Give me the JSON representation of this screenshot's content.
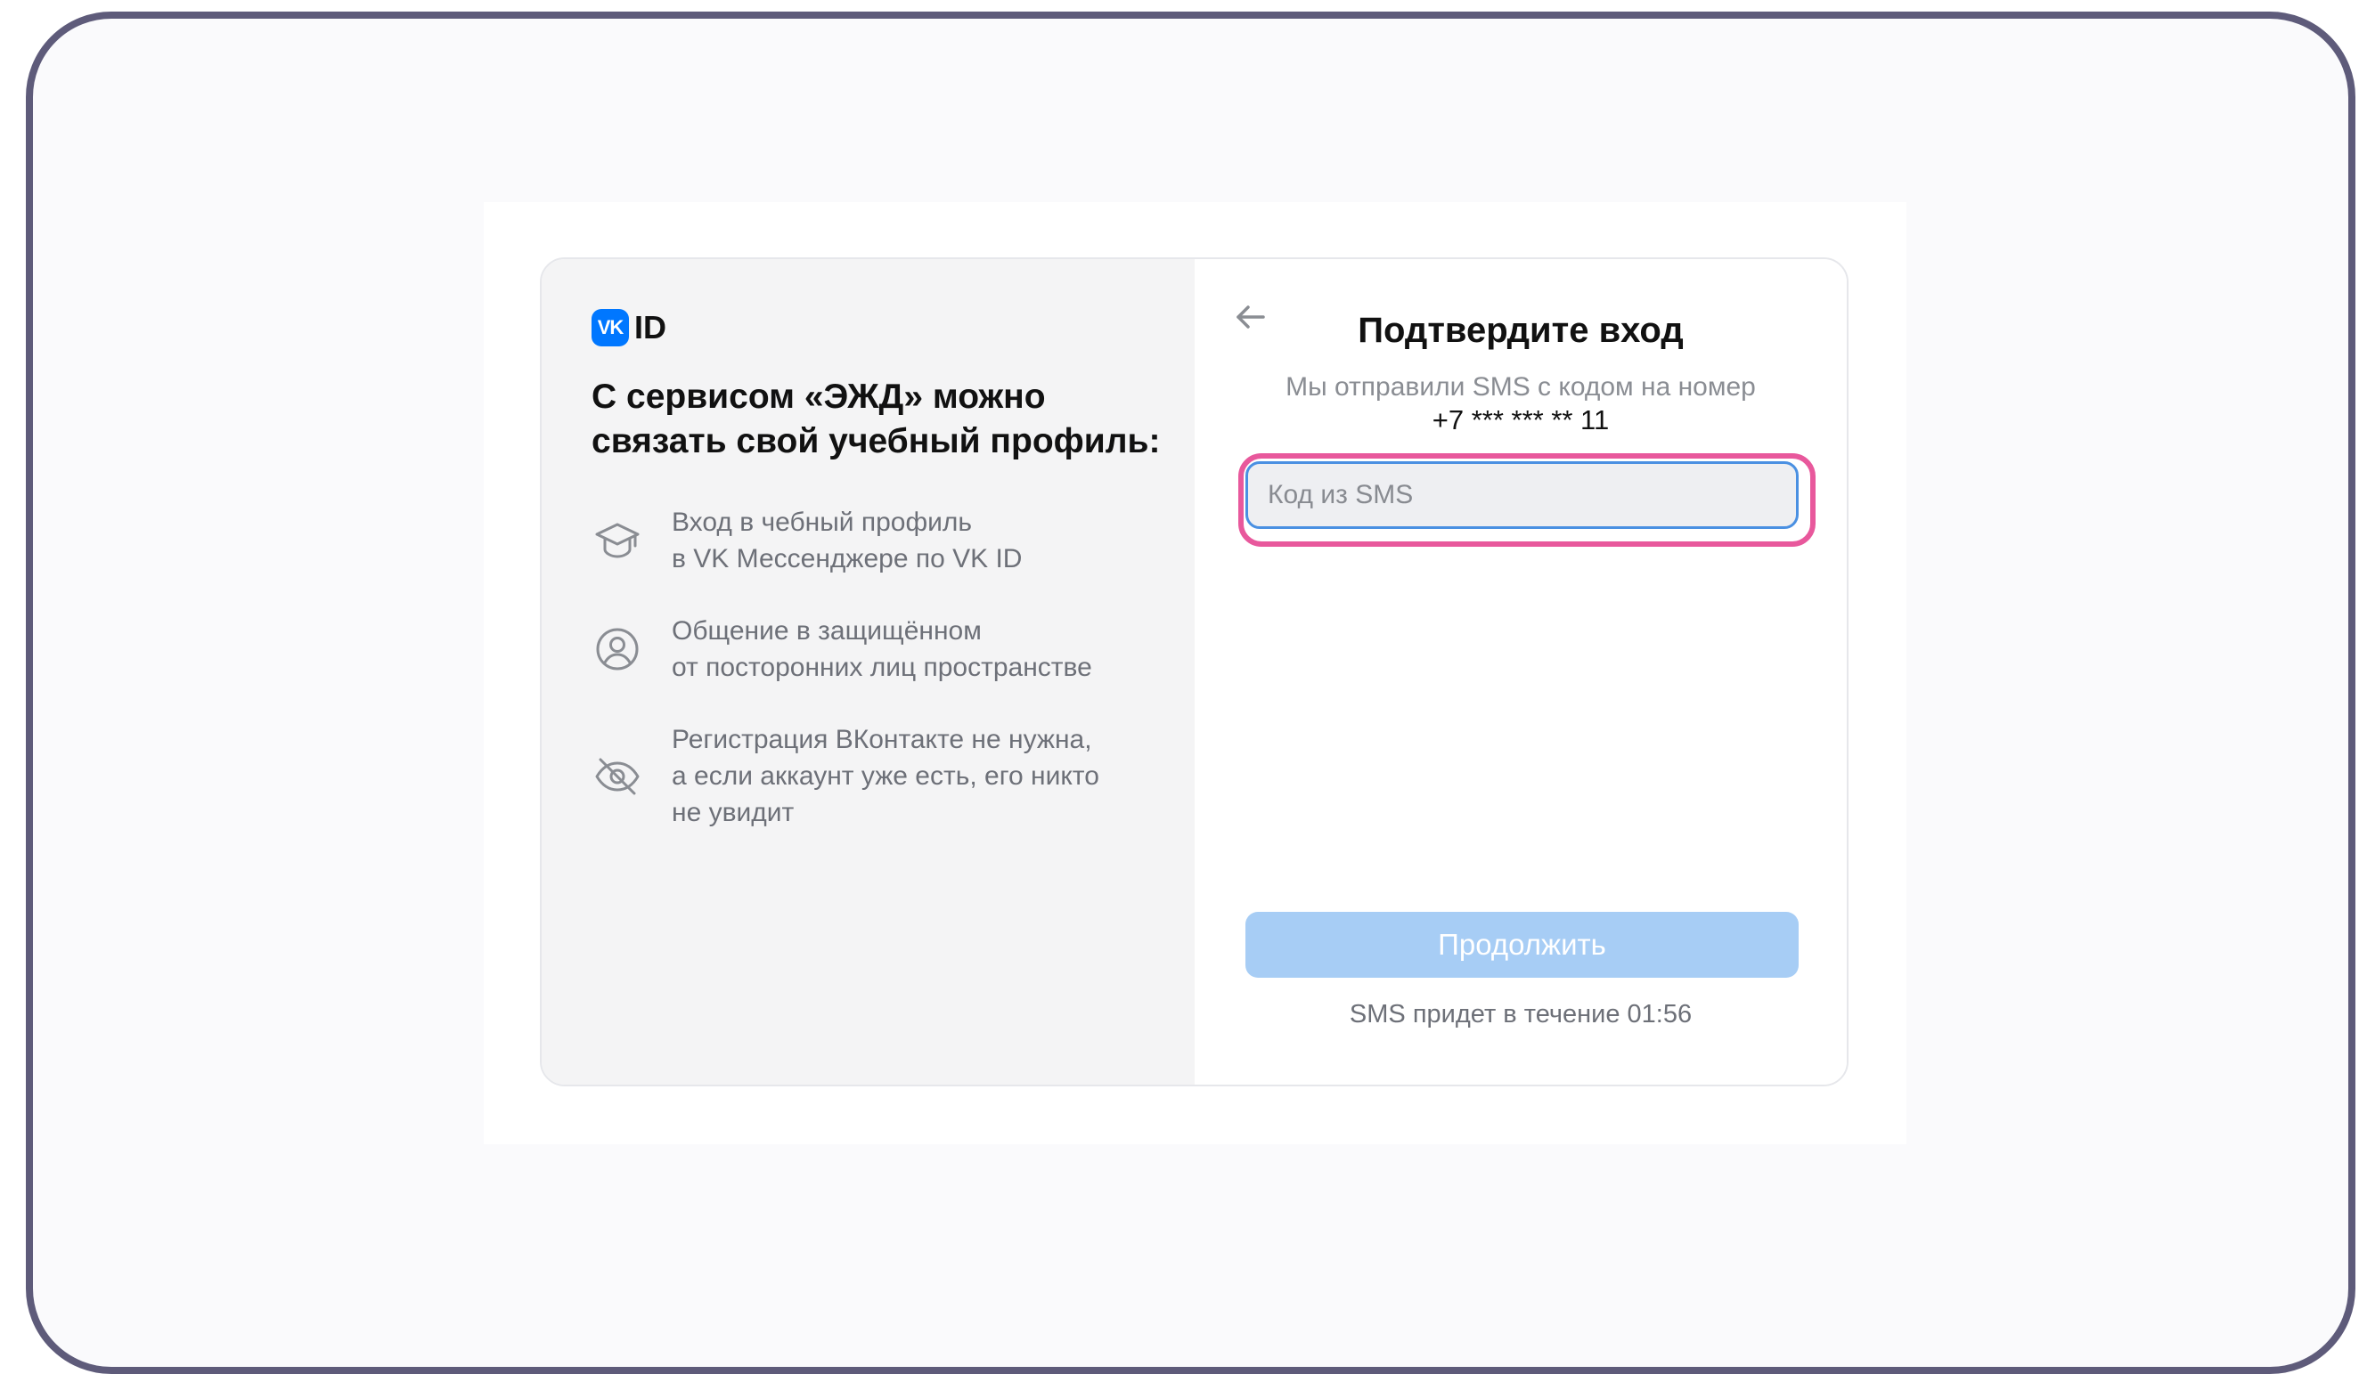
{
  "brand": {
    "logo_text": "VK",
    "name": "ID"
  },
  "left_panel": {
    "heading": "С сервисом «ЭЖД» можно связать свой учебный профиль:",
    "features": [
      {
        "icon": "graduation-cap-icon",
        "line1": "Вход в чебный профиль",
        "line2": "в VK Мессенджере по VK ID",
        "line3": ""
      },
      {
        "icon": "user-circle-icon",
        "line1": "Общение в защищённом",
        "line2": "от посторонних лиц пространстве",
        "line3": ""
      },
      {
        "icon": "eye-off-icon",
        "line1": "Регистрация ВКонтакте не нужна,",
        "line2": "а если аккаунт уже есть, его никто",
        "line3": "не увидит"
      }
    ]
  },
  "right_panel": {
    "back_icon": "arrow-left-icon",
    "title": "Подтвердите вход",
    "subtitle": "Мы отправили SMS с кодом на номер",
    "phone": "+7 *** *** ** 11",
    "sms_input": {
      "placeholder": "Код из SMS",
      "value": ""
    },
    "continue_label": "Продолжить",
    "timer_text": "SMS придет в течение 01:56"
  },
  "colors": {
    "accent": "#0077ff",
    "button_disabled": "#a7cdf5",
    "highlight": "#e8589c",
    "input_border": "#4a90e2"
  }
}
